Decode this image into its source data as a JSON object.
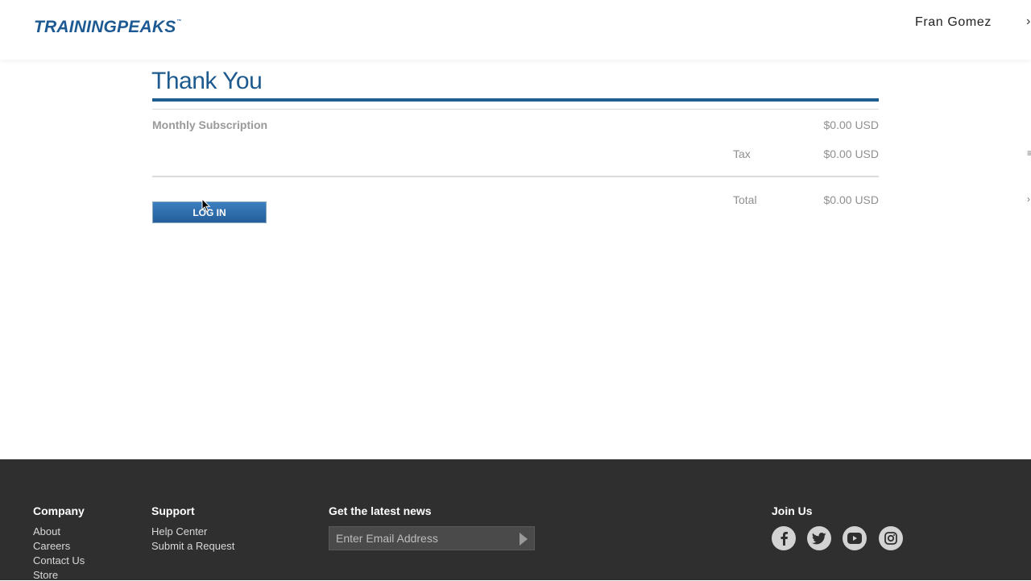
{
  "header": {
    "logo_text": "TRAININGPEAKS",
    "logo_tm": "™",
    "user_name": "Fran Gomez"
  },
  "main": {
    "title": "Thank You",
    "subscription_label": "Monthly Subscription",
    "subscription_price": "$0.00 USD",
    "tax_label": "Tax",
    "tax_value": "$0.00 USD",
    "total_label": "Total",
    "total_value": "$0.00 USD",
    "login_button": "LOG IN"
  },
  "footer": {
    "company": {
      "title": "Company",
      "links": [
        "About",
        "Careers",
        "Contact Us",
        "Store"
      ]
    },
    "support": {
      "title": "Support",
      "links": [
        "Help Center",
        "Submit a Request"
      ]
    },
    "news": {
      "title": "Get the latest news",
      "email_placeholder": "Enter Email Address"
    },
    "join": {
      "title": "Join Us",
      "icons": [
        "facebook-icon",
        "twitter-icon",
        "youtube-icon",
        "instagram-icon"
      ]
    }
  },
  "colors": {
    "brand_blue": "#1d5a93",
    "footer_bg": "#2f2f2f",
    "button_blue": "#2d6aa8"
  }
}
